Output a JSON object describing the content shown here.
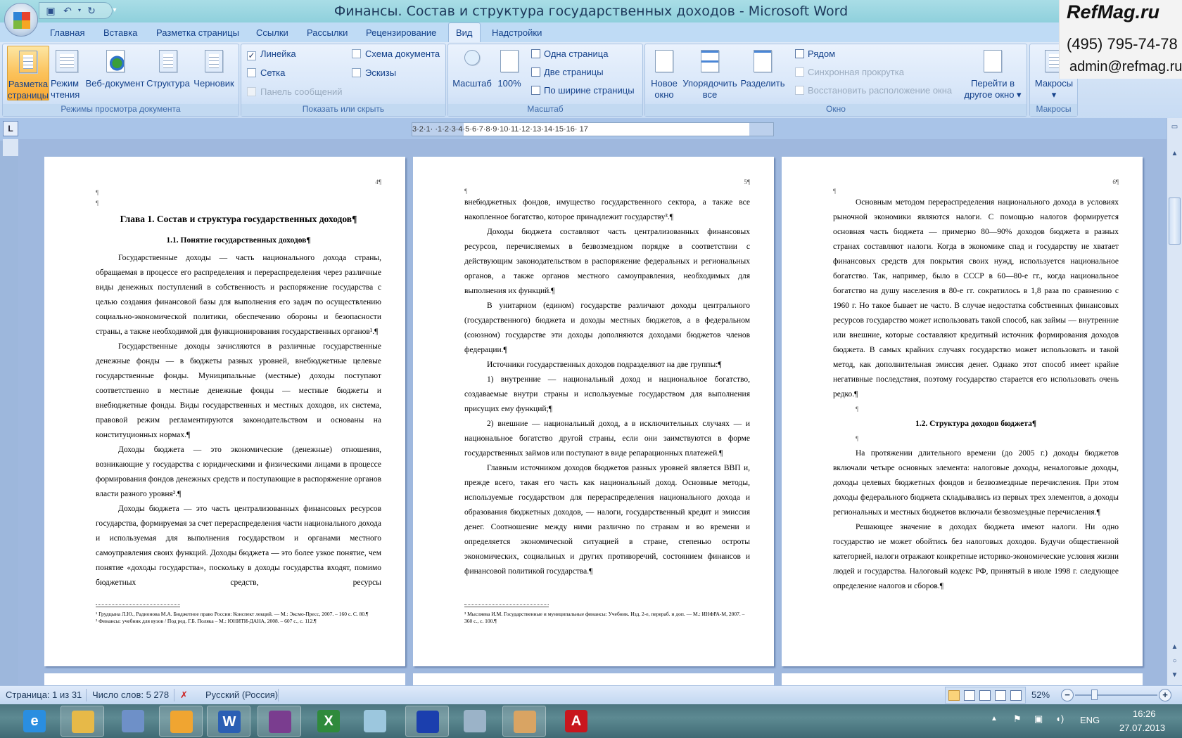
{
  "window": {
    "title": "Финансы. Состав и структура государственных доходов - Microsoft Word"
  },
  "quick_access": {
    "items": [
      {
        "icon": "save-icon"
      },
      {
        "icon": "undo-icon"
      },
      {
        "icon": "redo-icon"
      },
      {
        "icon": "customize-icon"
      }
    ]
  },
  "tabs": [
    {
      "label": "Главная"
    },
    {
      "label": "Вставка"
    },
    {
      "label": "Разметка страницы"
    },
    {
      "label": "Ссылки"
    },
    {
      "label": "Рассылки"
    },
    {
      "label": "Рецензирование"
    },
    {
      "label": "Вид",
      "active": true
    },
    {
      "label": "Надстройки"
    }
  ],
  "ribbon": {
    "views": {
      "label": "Режимы просмотра документа",
      "buttons": [
        {
          "label": "Разметка страницы",
          "active": true
        },
        {
          "label": "Режим чтения"
        },
        {
          "label": "Веб-документ"
        },
        {
          "label": "Структура"
        },
        {
          "label": "Черновик"
        }
      ]
    },
    "show_hide": {
      "label": "Показать или скрыть",
      "items": [
        {
          "label": "Линейка",
          "checked": true
        },
        {
          "label": "Сетка",
          "checked": false
        },
        {
          "label": "Панель сообщений",
          "checked": false,
          "disabled": true
        },
        {
          "label": "Схема документа",
          "checked": false
        },
        {
          "label": "Эскизы",
          "checked": false
        }
      ]
    },
    "zoom": {
      "label": "Масштаб",
      "zoom_button": "Масштаб",
      "hundred": "100%",
      "one_page": "Одна страница",
      "two_pages": "Две страницы",
      "page_width": "По ширине страницы"
    },
    "window": {
      "label": "Окно",
      "new_window": "Новое окно",
      "arrange_all": "Упорядочить все",
      "split": "Разделить",
      "side_by_side": "Рядом",
      "sync_scroll": "Синхронная прокрутка",
      "reset_position": "Восстановить расположение окна",
      "switch_windows": "Перейти в другое окно"
    },
    "macros": {
      "label": "Макросы",
      "button": "Макросы"
    }
  },
  "watermark": {
    "logo": "RefMag.ru",
    "phone": "(495) 795-74-78",
    "email": "admin@refmag.ru"
  },
  "ruler": {
    "labels": "3·2·1·  ·1·2·3·4·5·6·7·8·9·10·11·12·13·14·15·16·  17"
  },
  "pages": [
    {
      "blocks": [
        {
          "type": "pnum",
          "text": "4¶"
        },
        {
          "type": "pm",
          "text": "¶"
        },
        {
          "type": "pm",
          "text": "¶"
        },
        {
          "type": "h1",
          "text": "Глава 1. Состав и структура государственных доходов¶"
        },
        {
          "type": "h2",
          "text": "1.1. Понятие государственных доходов¶"
        },
        {
          "type": "p",
          "text": "Государственные доходы — часть национального дохода страны, обращаемая в процессе его распределения и перераспределения через различные виды денежных поступлений в собственность и распоряжение государства с целью создания финансовой базы для выполнения его задач по осуществлению социально-экономической политики, обеспечению обороны и безопасности страны, а также необходимой для функционирования государственных органов¹.¶"
        },
        {
          "type": "p",
          "text": "Государственные доходы зачисляются в различные государственные денежные фонды — в бюджеты разных уровней, внебюджетные целевые государственные фонды. Муниципальные (местные) доходы поступают соответственно в местные денежные фонды — местные бюджеты и внебюджетные фонды. Виды государственных и местных доходов, их система, правовой режим регламентируются законодательством и основаны на конституционных нормах.¶"
        },
        {
          "type": "p",
          "text": "Доходы бюджета — это экономические (денежные) отношения, возникающие у государства с юридическими и физическими лицами в процессе формирования фондов денежных средств и поступающие в распоряжение органов власти разного уровня².¶"
        },
        {
          "type": "p jl",
          "text": "Доходы бюджета — это часть централизованных финансовых ресурсов государства, формируемая за счет перераспределения части национального дохода и используемая для выполнения государством и органами местного самоуправления своих функций. Доходы бюджета — это более узкое понятие, чем понятие «доходы государства», поскольку в доходы государства входят, помимо бюджетных средств, ресурсы"
        }
      ],
      "footnotes": [
        "¹ Грудцына Л.Ю., Радионова М.А. Бюджетное право России: Конспект лекций. — М.: Эксмо-Пресс, 2007. – 160 с. С. 80.¶",
        "² Финансы: учебник для вузов / Под ред. Г.Б. Поляка – М.: ЮНИТИ-ДАНА, 2008. – 607 с., с. 112.¶"
      ]
    },
    {
      "blocks": [
        {
          "type": "pnum",
          "text": "5¶"
        },
        {
          "type": "pm tight",
          "text": "¶"
        },
        {
          "type": "p cont",
          "text": "внебюджетных фондов, имущество государственного сектора, а также все накопленное богатство, которое принадлежит государству³.¶"
        },
        {
          "type": "p",
          "text": "Доходы бюджета составляют часть централизованных финансовых ресурсов, перечисляемых в безвозмездном порядке в соответствии с действующим законодательством в распоряжение федеральных и региональных органов, а также органов местного самоуправления, необходимых для выполнения их функций.¶"
        },
        {
          "type": "p",
          "text": "В унитарном (едином) государстве различают доходы центрального (государственного) бюджета и доходы местных бюджетов, а в федеральном (союзном) государстве эти доходы дополняются доходами бюджетов членов федерации.¶"
        },
        {
          "type": "p",
          "text": "Источники государственных доходов подразделяют на две группы:¶"
        },
        {
          "type": "p",
          "text": "1) внутренние — национальный доход и национальное богатство, создаваемые внутри страны и используемые государством для выполнения присущих ему функций;¶"
        },
        {
          "type": "p",
          "text": "2) внешние — национальный доход, а в исключительных случаях — и национальное богатство другой страны, если они заимствуются в форме государственных займов или поступают в виде репарационных платежей.¶"
        },
        {
          "type": "p",
          "text": "Главным источником доходов бюджетов разных уровней является ВВП и, прежде всего, такая его часть как национальный доход. Основные методы, используемые государством для перераспределения национального дохода и образования бюджетных доходов, — налоги, государственный кредит и эмиссия денег. Соотношение между ними различно по странам и во времени и определяется экономической ситуацией в стране, степенью остроты экономических, социальных и других противоречий, состоянием финансов и финансовой политикой государства.¶"
        }
      ],
      "footnotes": [
        "³ Мысляева И.М. Государственные и муниципальные финансы: Учебник. Изд. 2-е, перераб. и доп. — М.: ИНФРА-М, 2007. – 360 с., с. 100.¶"
      ]
    },
    {
      "blocks": [
        {
          "type": "pnum",
          "text": "6¶"
        },
        {
          "type": "pm tight",
          "text": "¶"
        },
        {
          "type": "p",
          "text": "Основным методом перераспределения национального дохода в условиях рыночной экономики являются налоги. С помощью налогов формируется основная часть бюджета — примерно 80—90% доходов бюджета в разных странах составляют налоги. Когда в экономике спад и государству не хватает финансовых средств для покрытия своих нужд, используется национальное богатство. Так, например, было в СССР в 60—80-е гг., когда национальное богатство на душу населения в 80-е гг. сократилось в 1,8 раза по сравнению с 1960 г. Но такое бывает не часто. В случае недостатка собственных финансовых ресурсов государство может использовать такой способ, как займы — внутренние или внешние, которые составляют кредитный источник формирования доходов бюджета. В самых крайних случаях государство может использовать и такой метод, как дополнительная эмиссия денег. Однако этот способ имеет крайне негативные последствия, поэтому государство старается его использовать очень редко.¶"
        },
        {
          "type": "pm ind",
          "text": "¶"
        },
        {
          "type": "h2n",
          "text": "1.2. Структура доходов бюджета¶"
        },
        {
          "type": "pm ind",
          "text": "¶"
        },
        {
          "type": "p",
          "text": "На протяжении длительного времени (до 2005 г.) доходы бюджетов включали четыре основных элемента: налоговые доходы, неналоговые доходы, доходы целевых бюджетных фондов и безвозмездные перечисления. При этом доходы федерального бюджета складывались из первых трех элементов, а доходы региональных и местных бюджетов включали безвозмездные перечисления.¶"
        },
        {
          "type": "p",
          "text": "Решающее значение в доходах бюджета имеют налоги. Ни одно государство не может обойтись без налоговых доходов. Будучи общественной категорией, налоги отражают конкретные историко-экономические условия жизни людей и государства. Налоговый кодекс РФ, принятый в июле 1998 г. следующее определение налогов и сборов.¶"
        }
      ],
      "footnotes": []
    }
  ],
  "statusbar": {
    "page": "Страница: 1 из 31",
    "words": "Число слов: 5 278",
    "language": "Русский (Россия)",
    "zoom": "52%",
    "zoom_percent": 52
  },
  "taskbar": {
    "apps": [
      {
        "icon": "internet-explorer-icon",
        "color": "#2a8ee0",
        "glyph": "e",
        "open": false
      },
      {
        "icon": "windows-explorer-icon",
        "color": "#e7b948",
        "glyph": "",
        "open": true
      },
      {
        "icon": "network-connect-icon",
        "color": "#6e90c8",
        "glyph": "",
        "open": false
      },
      {
        "icon": "mail-client-icon",
        "color": "#f0a531",
        "glyph": "",
        "open": true
      },
      {
        "icon": "word-icon",
        "color": "#2b5fb4",
        "glyph": "W",
        "open": true
      },
      {
        "icon": "winrar-icon",
        "color": "#7a3d8f",
        "glyph": "",
        "open": true
      },
      {
        "icon": "excel-icon",
        "color": "#2f8a3c",
        "glyph": "X",
        "open": false
      },
      {
        "icon": "notepad-icon",
        "color": "#9cc7de",
        "glyph": "",
        "open": false
      },
      {
        "icon": "file-manager-icon",
        "color": "#1b3fae",
        "glyph": "",
        "open": true
      },
      {
        "icon": "calculator-icon",
        "color": "#9bb3c8",
        "glyph": "",
        "open": false
      },
      {
        "icon": "paint-icon",
        "color": "#d9a463",
        "glyph": "",
        "open": true
      },
      {
        "icon": "acrobat-reader-icon",
        "color": "#c8161d",
        "glyph": "A",
        "open": false
      }
    ],
    "tray": {
      "language": "ENG",
      "time": "16:26",
      "date": "27.07.2013"
    }
  }
}
